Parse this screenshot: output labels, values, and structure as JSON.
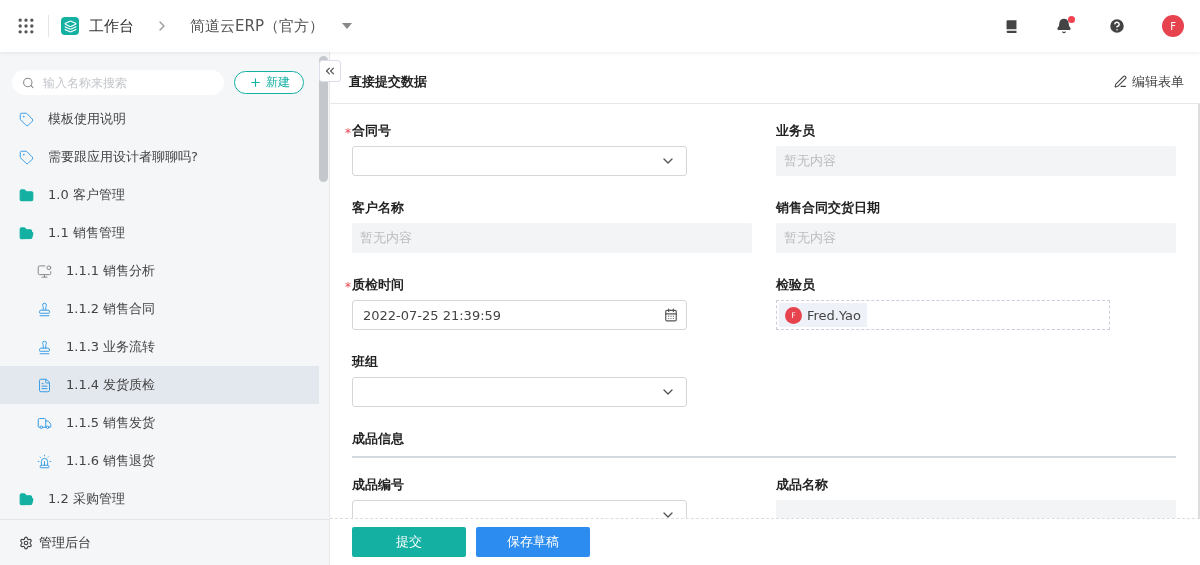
{
  "topbar": {
    "home": "工作台",
    "app": "简道云ERP（官方）",
    "avatar": "F",
    "notification_dot": true
  },
  "sidebar": {
    "search": {
      "placeholder": "输入名称来搜索"
    },
    "new_button": "新建",
    "items": [
      {
        "kind": "tag",
        "label": "模板使用说明",
        "selected": false
      },
      {
        "kind": "tag",
        "label": "需要跟应用设计者聊聊吗?",
        "selected": false
      },
      {
        "kind": "folder",
        "label": "1.0 客户管理",
        "selected": false,
        "expanded": false
      },
      {
        "kind": "folder",
        "label": "1.1 销售管理",
        "selected": false,
        "expanded": true,
        "children": [
          {
            "kind": "chart",
            "label": "1.1.1 销售分析",
            "selected": false
          },
          {
            "kind": "stamp",
            "label": "1.1.2 销售合同",
            "selected": false
          },
          {
            "kind": "stamp",
            "label": "1.1.3 业务流转",
            "selected": false
          },
          {
            "kind": "form",
            "label": "1.1.4 发货质检",
            "selected": true
          },
          {
            "kind": "truck",
            "label": "1.1.5 销售发货",
            "selected": false
          },
          {
            "kind": "alarm",
            "label": "1.1.6 销售退货",
            "selected": false
          }
        ]
      },
      {
        "kind": "folder",
        "label": "1.2 采购管理",
        "selected": false,
        "expanded": true
      }
    ],
    "footer": "管理后台"
  },
  "form": {
    "title": "直接提交数据",
    "edit_link": "编辑表单",
    "required_mark": "*",
    "blocks": [
      {
        "kind": "row",
        "fields": [
          {
            "kind": "select",
            "label": "合同号",
            "required": true
          },
          {
            "kind": "readonly",
            "label": "业务员",
            "placeholder": "暂无内容"
          }
        ]
      },
      {
        "kind": "row",
        "fields": [
          {
            "kind": "readonly",
            "label": "客户名称",
            "placeholder": "暂无内容"
          },
          {
            "kind": "readonly",
            "label": "销售合同交货日期",
            "placeholder": "暂无内容"
          }
        ]
      },
      {
        "kind": "row",
        "fields": [
          {
            "kind": "date",
            "label": "质检时间",
            "required": true,
            "value": "2022-07-25 21:39:59"
          },
          {
            "kind": "user",
            "label": "检验员",
            "user": {
              "initial": "F",
              "name": "Fred.Yao"
            }
          }
        ]
      },
      {
        "kind": "row",
        "fields": [
          {
            "kind": "select",
            "label": "班组"
          }
        ]
      },
      {
        "kind": "section",
        "title": "成品信息"
      },
      {
        "kind": "row",
        "fields": [
          {
            "kind": "select",
            "label": "成品编号"
          },
          {
            "kind": "readonly",
            "label": "成品名称"
          }
        ]
      }
    ],
    "buttons": [
      {
        "kind": "primary",
        "label": "提交"
      },
      {
        "kind": "secondary",
        "label": "保存草稿"
      }
    ]
  }
}
